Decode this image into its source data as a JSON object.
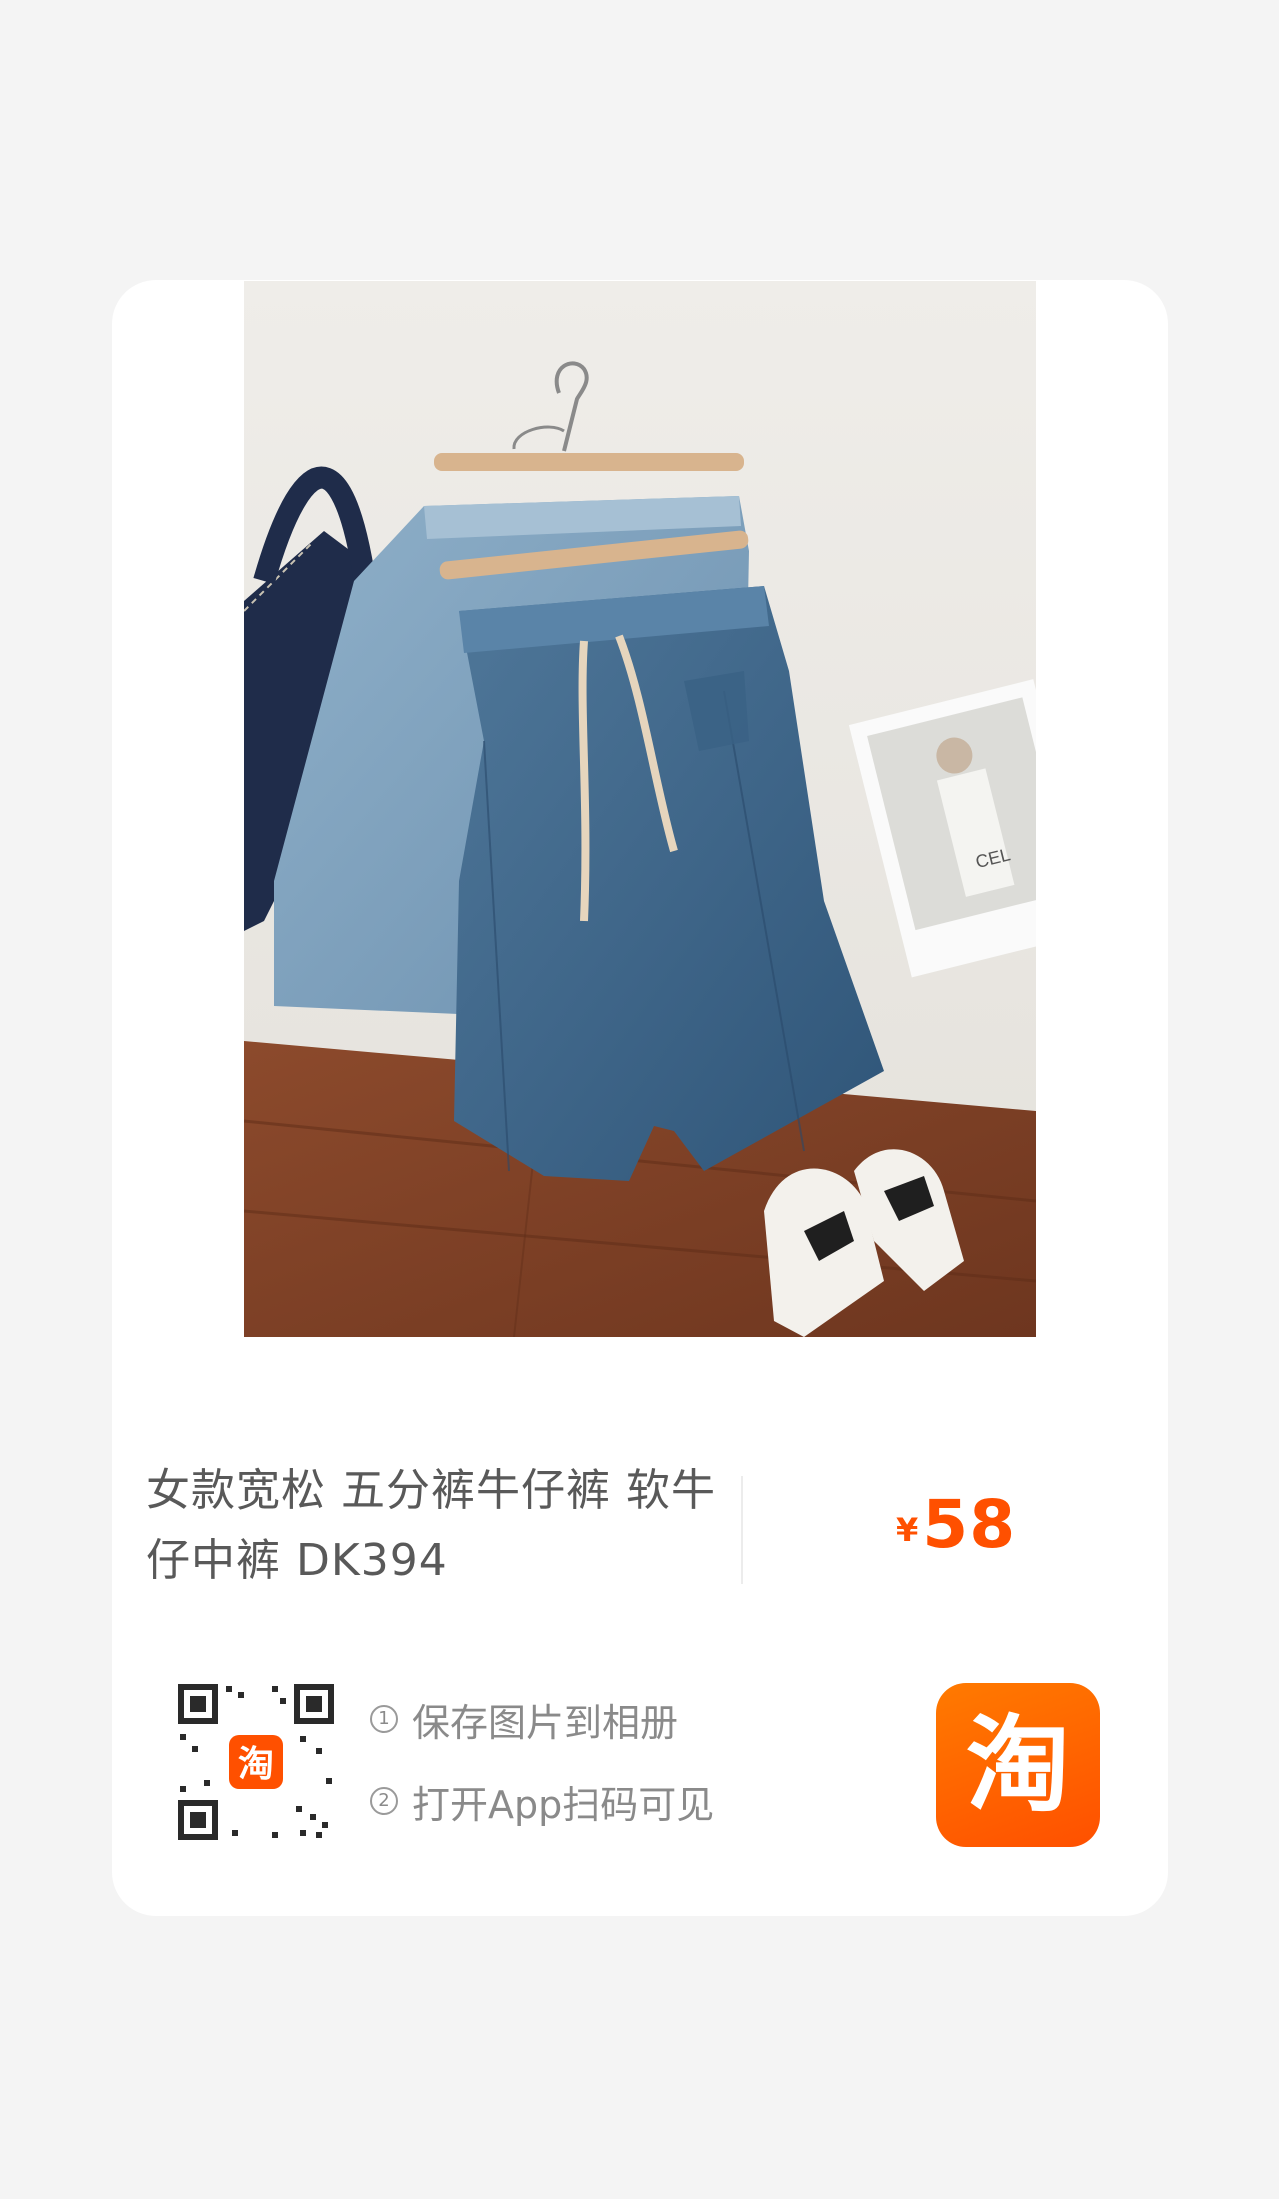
{
  "product": {
    "title": "女款宽松 五分裤牛仔裤 软牛仔中裤 DK394",
    "price_symbol": "¥",
    "price_value": "58",
    "photo_sign_text": "CEL"
  },
  "qr": {
    "logo_text": "淘"
  },
  "steps": [
    {
      "num": "1",
      "text": "保存图片到相册"
    },
    {
      "num": "2",
      "text": "打开App扫码可见"
    }
  ],
  "app_icon": {
    "glyph": "淘"
  },
  "colors": {
    "accent": "#ff5000",
    "background": "#f4f4f4",
    "card": "#ffffff"
  }
}
